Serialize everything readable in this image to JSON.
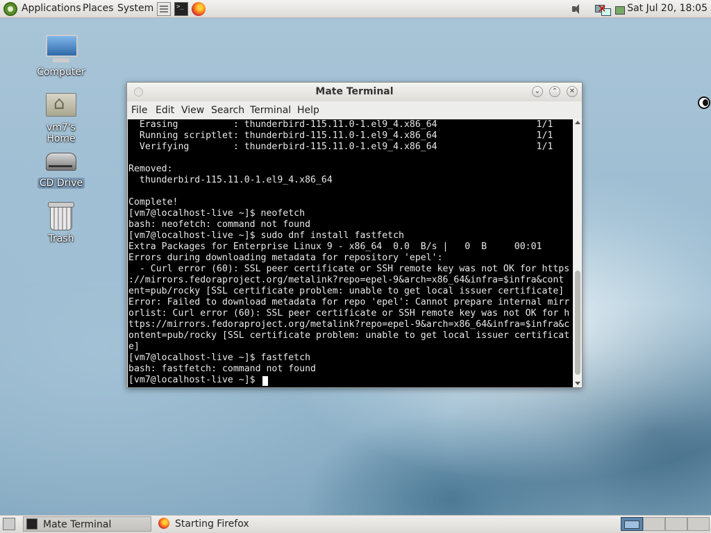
{
  "top_panel": {
    "menus": [
      "Applications",
      "Places",
      "System"
    ],
    "launchers": [
      "file-manager-icon",
      "terminal-icon",
      "firefox-icon"
    ],
    "tray": [
      "volume-icon",
      "network-icon",
      "power-icon"
    ],
    "clock": "Sat Jul 20, 18:05"
  },
  "desktop_icons": [
    {
      "label": "Computer",
      "icon": "computer-icon"
    },
    {
      "label": "vm7's Home",
      "icon": "home-folder-icon"
    },
    {
      "label": "CD Drive",
      "icon": "cd-drive-icon"
    },
    {
      "label": "Trash",
      "icon": "trash-icon"
    }
  ],
  "terminal": {
    "title": "Mate Terminal",
    "menu": [
      "File",
      "Edit",
      "View",
      "Search",
      "Terminal",
      "Help"
    ],
    "lines": [
      "  Erasing          : thunderbird-115.11.0-1.el9_4.x86_64                  1/1",
      "  Running scriptlet: thunderbird-115.11.0-1.el9_4.x86_64                  1/1",
      "  Verifying        : thunderbird-115.11.0-1.el9_4.x86_64                  1/1",
      "",
      "Removed:",
      "  thunderbird-115.11.0-1.el9_4.x86_64",
      "",
      "Complete!",
      "[vm7@localhost-live ~]$ neofetch",
      "bash: neofetch: command not found",
      "[vm7@localhost-live ~]$ sudo dnf install fastfetch",
      "Extra Packages for Enterprise Linux 9 - x86_64  0.0  B/s |   0  B     00:01",
      "Errors during downloading metadata for repository 'epel':",
      "  - Curl error (60): SSL peer certificate or SSH remote key was not OK for https",
      "://mirrors.fedoraproject.org/metalink?repo=epel-9&arch=x86_64&infra=$infra&cont",
      "ent=pub/rocky [SSL certificate problem: unable to get local issuer certificate]",
      "Error: Failed to download metadata for repo 'epel': Cannot prepare internal mirr",
      "orlist: Curl error (60): SSL peer certificate or SSH remote key was not OK for h",
      "ttps://mirrors.fedoraproject.org/metalink?repo=epel-9&arch=x86_64&infra=$infra&c",
      "ontent=pub/rocky [SSL certificate problem: unable to get local issuer certificat",
      "e]",
      "[vm7@localhost-live ~]$ fastfetch",
      "bash: fastfetch: command not found",
      "[vm7@localhost-live ~]$ "
    ]
  },
  "taskbar": {
    "tasks": [
      {
        "label": "Mate Terminal",
        "icon": "terminal-icon",
        "active": true
      },
      {
        "label": "Starting Firefox",
        "icon": "firefox-icon",
        "active": false
      }
    ],
    "workspaces": 4,
    "active_workspace": 1
  }
}
